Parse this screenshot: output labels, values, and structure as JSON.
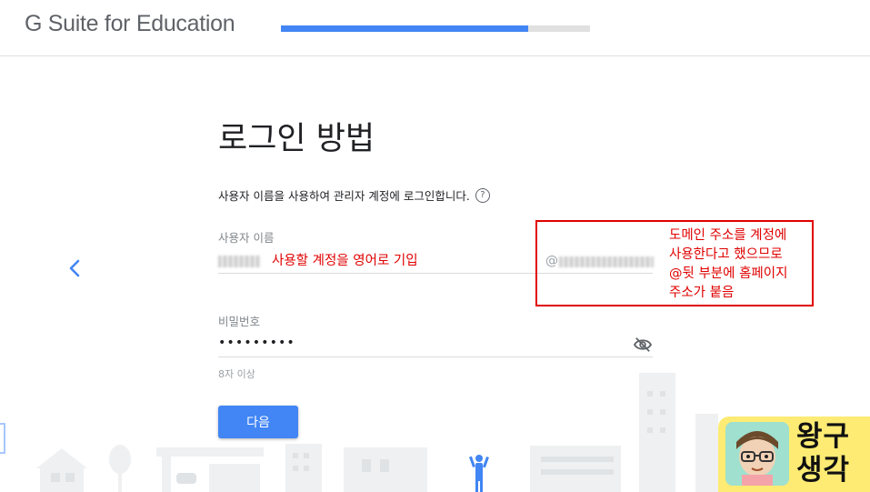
{
  "header": {
    "logo_text": "G Suite for Education",
    "progress_fraction": 0.8
  },
  "main": {
    "title": "로그인 방법",
    "subtitle": "사용자 이름을 사용하여 관리자 계정에 로그인합니다.",
    "help_icon_glyph": "?",
    "username": {
      "label": "사용자 이름",
      "domain_prefix": "@"
    },
    "password": {
      "label": "비밀번호",
      "value": "•••••••••",
      "hint": "8자 이상"
    },
    "next_button": "다음"
  },
  "annotations": {
    "inline": "사용할 계정을 영어로 기입",
    "box_lines": [
      "도메인 주소를 계정에",
      "사용한다고 했으므로",
      "@뒷 부분에 홈페이지",
      "주소가 붙음"
    ],
    "color": "#e00000"
  },
  "badge": {
    "line1": "왕구",
    "line2": "생각"
  },
  "icons": {
    "back": "chevron-left-icon",
    "eye": "visibility-off-icon",
    "help": "help-circle-icon"
  },
  "colors": {
    "accent": "#4285f4",
    "annotation": "#e00000",
    "badge_bg": "#fdeb73"
  }
}
